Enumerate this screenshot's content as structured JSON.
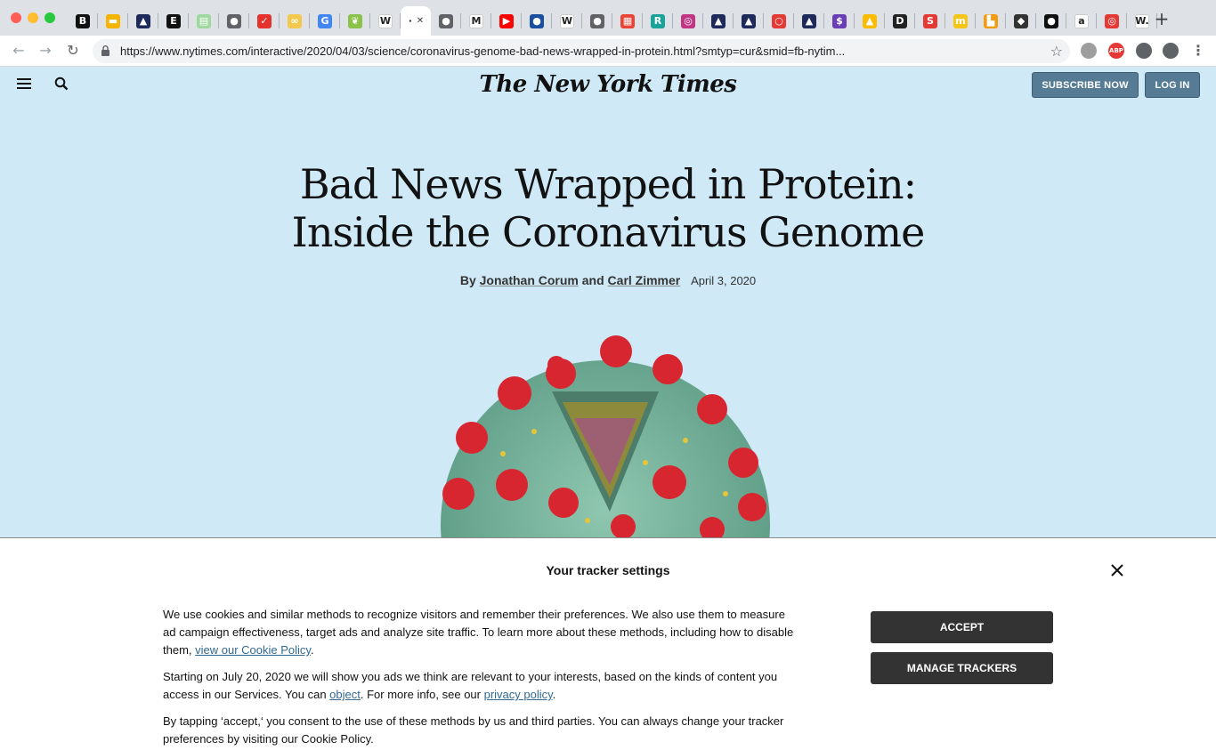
{
  "browser": {
    "url": "https://www.nytimes.com/interactive/2020/04/03/science/coronavirus-genome-bad-news-wrapped-in-protein.html?smtyp=cur&smid=fb-nytim...",
    "tabs": [
      {
        "icon": "b-icon",
        "color": "#111111",
        "glyph": "B"
      },
      {
        "icon": "slides-icon",
        "color": "#f4b400",
        "glyph": "▬"
      },
      {
        "icon": "mountain-icon",
        "color": "#1e2a5a",
        "glyph": "▲"
      },
      {
        "icon": "e-icon",
        "color": "#111111",
        "glyph": "E"
      },
      {
        "icon": "sheets-icon",
        "color": "#9fd8a0",
        "glyph": "▤"
      },
      {
        "icon": "globe-icon",
        "color": "#5f6368",
        "glyph": "●"
      },
      {
        "icon": "pocket-icon",
        "color": "#e5322d",
        "glyph": "✓"
      },
      {
        "icon": "cc-icon",
        "color": "#f2c94c",
        "glyph": "∞"
      },
      {
        "icon": "google-icon",
        "color": "#4285f4",
        "glyph": "G"
      },
      {
        "icon": "leaf-icon",
        "color": "#8bc34a",
        "glyph": "❦"
      },
      {
        "icon": "wikipedia-icon",
        "color": "#ffffff",
        "glyph": "W"
      },
      {
        "icon": "loading-icon",
        "color": "#ffffff",
        "glyph": "·",
        "active": true
      },
      {
        "icon": "globe-icon",
        "color": "#5f6368",
        "glyph": "●"
      },
      {
        "icon": "medium-icon",
        "color": "#ffffff",
        "glyph": "M"
      },
      {
        "icon": "youtube-icon",
        "color": "#ff0000",
        "glyph": "▶"
      },
      {
        "icon": "circle-icon",
        "color": "#1a4fa0",
        "glyph": "●"
      },
      {
        "icon": "wikipedia-icon",
        "color": "#ffffff",
        "glyph": "W"
      },
      {
        "icon": "globe-icon",
        "color": "#5f6368",
        "glyph": "●"
      },
      {
        "icon": "grid-icon",
        "color": "#ea4335",
        "glyph": "▦"
      },
      {
        "icon": "r-icon",
        "color": "#1aa39a",
        "glyph": "R"
      },
      {
        "icon": "instagram-icon",
        "color": "#c13584",
        "glyph": "◎"
      },
      {
        "icon": "mountain-icon",
        "color": "#1e2a5a",
        "glyph": "▲"
      },
      {
        "icon": "mountain-icon",
        "color": "#1e2a5a",
        "glyph": "▲"
      },
      {
        "icon": "ring-icon",
        "color": "#e53935",
        "glyph": "○"
      },
      {
        "icon": "mountain-icon",
        "color": "#1e2a5a",
        "glyph": "▲"
      },
      {
        "icon": "s-circle-icon",
        "color": "#6a3fb5",
        "glyph": "$"
      },
      {
        "icon": "drive-icon",
        "color": "#fbbc04",
        "glyph": "▲"
      },
      {
        "icon": "d-icon",
        "color": "#222222",
        "glyph": "D"
      },
      {
        "icon": "s-icon",
        "color": "#e53935",
        "glyph": "S"
      },
      {
        "icon": "m-icon",
        "color": "#f5c518",
        "glyph": "m"
      },
      {
        "icon": "blocks-icon",
        "color": "#f39c12",
        "glyph": "▙"
      },
      {
        "icon": "diamond-icon",
        "color": "#333333",
        "glyph": "◆"
      },
      {
        "icon": "black-circle-icon",
        "color": "#111111",
        "glyph": "●"
      },
      {
        "icon": "amazon-icon",
        "color": "#ffffff",
        "glyph": "a"
      },
      {
        "icon": "target-icon",
        "color": "#e53935",
        "glyph": "◎"
      },
      {
        "icon": "w-icon",
        "color": "#ffffff",
        "glyph": "W."
      }
    ],
    "new_tab_glyph": "+",
    "extensions": [
      {
        "icon": "cylinder-icon",
        "color": "#9e9e9e",
        "glyph": ""
      },
      {
        "icon": "adblock-icon",
        "color": "#e53935",
        "glyph": "ABP"
      },
      {
        "icon": "puzzle-icon",
        "color": "#5f6368",
        "glyph": ""
      },
      {
        "icon": "profile-icon",
        "color": "#5f6368",
        "glyph": ""
      }
    ]
  },
  "header": {
    "masthead": "The New York Times",
    "subscribe_label": "SUBSCRIBE NOW",
    "login_label": "LOG IN"
  },
  "article": {
    "headline_line1": "Bad News Wrapped in Protein:",
    "headline_line2": "Inside the Coronavirus Genome",
    "by": "By",
    "author1": "Jonathan Corum",
    "and": "and",
    "author2": "Carl Zimmer",
    "date": "April 3, 2020"
  },
  "tracker_modal": {
    "title": "Your tracker settings",
    "p1_text": "We use cookies and similar methods to recognize visitors and remember their preferences. We also use them to measure ad campaign effectiveness, target ads and analyze site traffic. To learn more about these methods, including how to disable them, ",
    "p1_link": "view our Cookie Policy",
    "p1_end": ".",
    "p2_text": "Starting on July 20, 2020 we will show you ads we think are relevant to your interests, based on the kinds of content you access in our Services. You can ",
    "p2_link1": "object",
    "p2_mid": ". For more info, see our ",
    "p2_link2": "privacy policy",
    "p2_end": ".",
    "p3_text": "By tapping ‘accept,‘ you consent to the use of these methods by us and third parties. You can always change your tracker preferences by visiting our Cookie Policy.",
    "accept_label": "ACCEPT",
    "manage_label": "MANAGE TRACKERS"
  },
  "colors": {
    "page_bg": "#cfe9f7",
    "header_button": "#567b95",
    "cta": "#333333",
    "link": "#326891"
  }
}
